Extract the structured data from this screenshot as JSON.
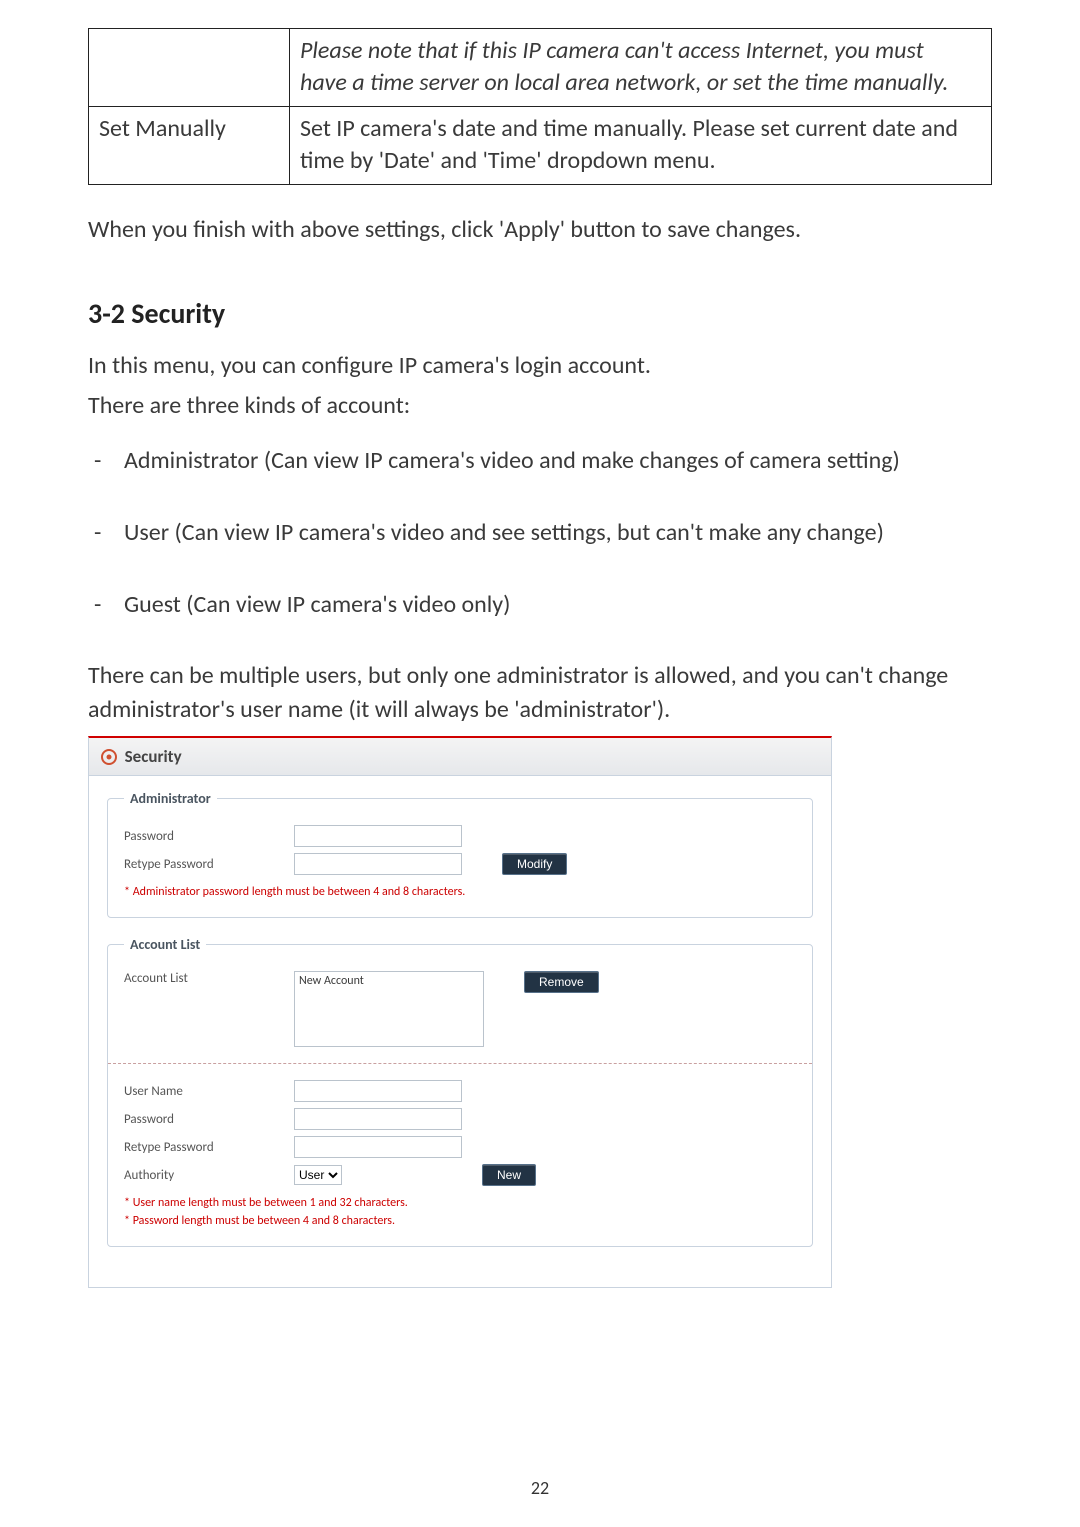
{
  "table": {
    "row1": {
      "left": "",
      "right_line1": "Please note that if this IP camera can't access Internet, you must",
      "right_line2": "have a time server on local area network, or set the time manually."
    },
    "row2": {
      "left": "Set Manually",
      "right_line1": "Set IP camera's date and time manually. Please set current date and",
      "right_line2": "time by 'Date' and 'Time' dropdown menu."
    }
  },
  "after_table": "When you finish with above settings, click 'Apply' button to save changes.",
  "section_heading": "3-2 Security",
  "intro_line1": "In this menu, you can configure IP camera's login account.",
  "intro_line2": "There are three kinds of account:",
  "roles": [
    "Administrator (Can view IP camera's video and make changes of camera setting)",
    "User (Can view IP camera's video and see settings, but can't make any change)",
    "Guest (Can view IP camera's video only)"
  ],
  "multi_user_note": "There can be multiple users, but only one administrator is allowed, and you can't change administrator's user name (it will always be 'administrator').",
  "panel": {
    "title": "Security",
    "admin": {
      "legend": "Administrator",
      "password_label": "Password",
      "retype_label": "Retype Password",
      "modify_btn": "Modify",
      "hint": "* Administrator password length must be between 4 and 8 characters."
    },
    "accounts": {
      "legend": "Account List",
      "list_label": "Account List",
      "list_item": "New Account",
      "remove_btn": "Remove",
      "username_label": "User Name",
      "password_label": "Password",
      "retype_label": "Retype Password",
      "authority_label": "Authority",
      "authority_value": "User",
      "new_btn": "New",
      "hint1": "* User name length must be between 1 and 32 characters.",
      "hint2": "* Password length must be between 4 and 8 characters."
    }
  },
  "page_number": "22"
}
